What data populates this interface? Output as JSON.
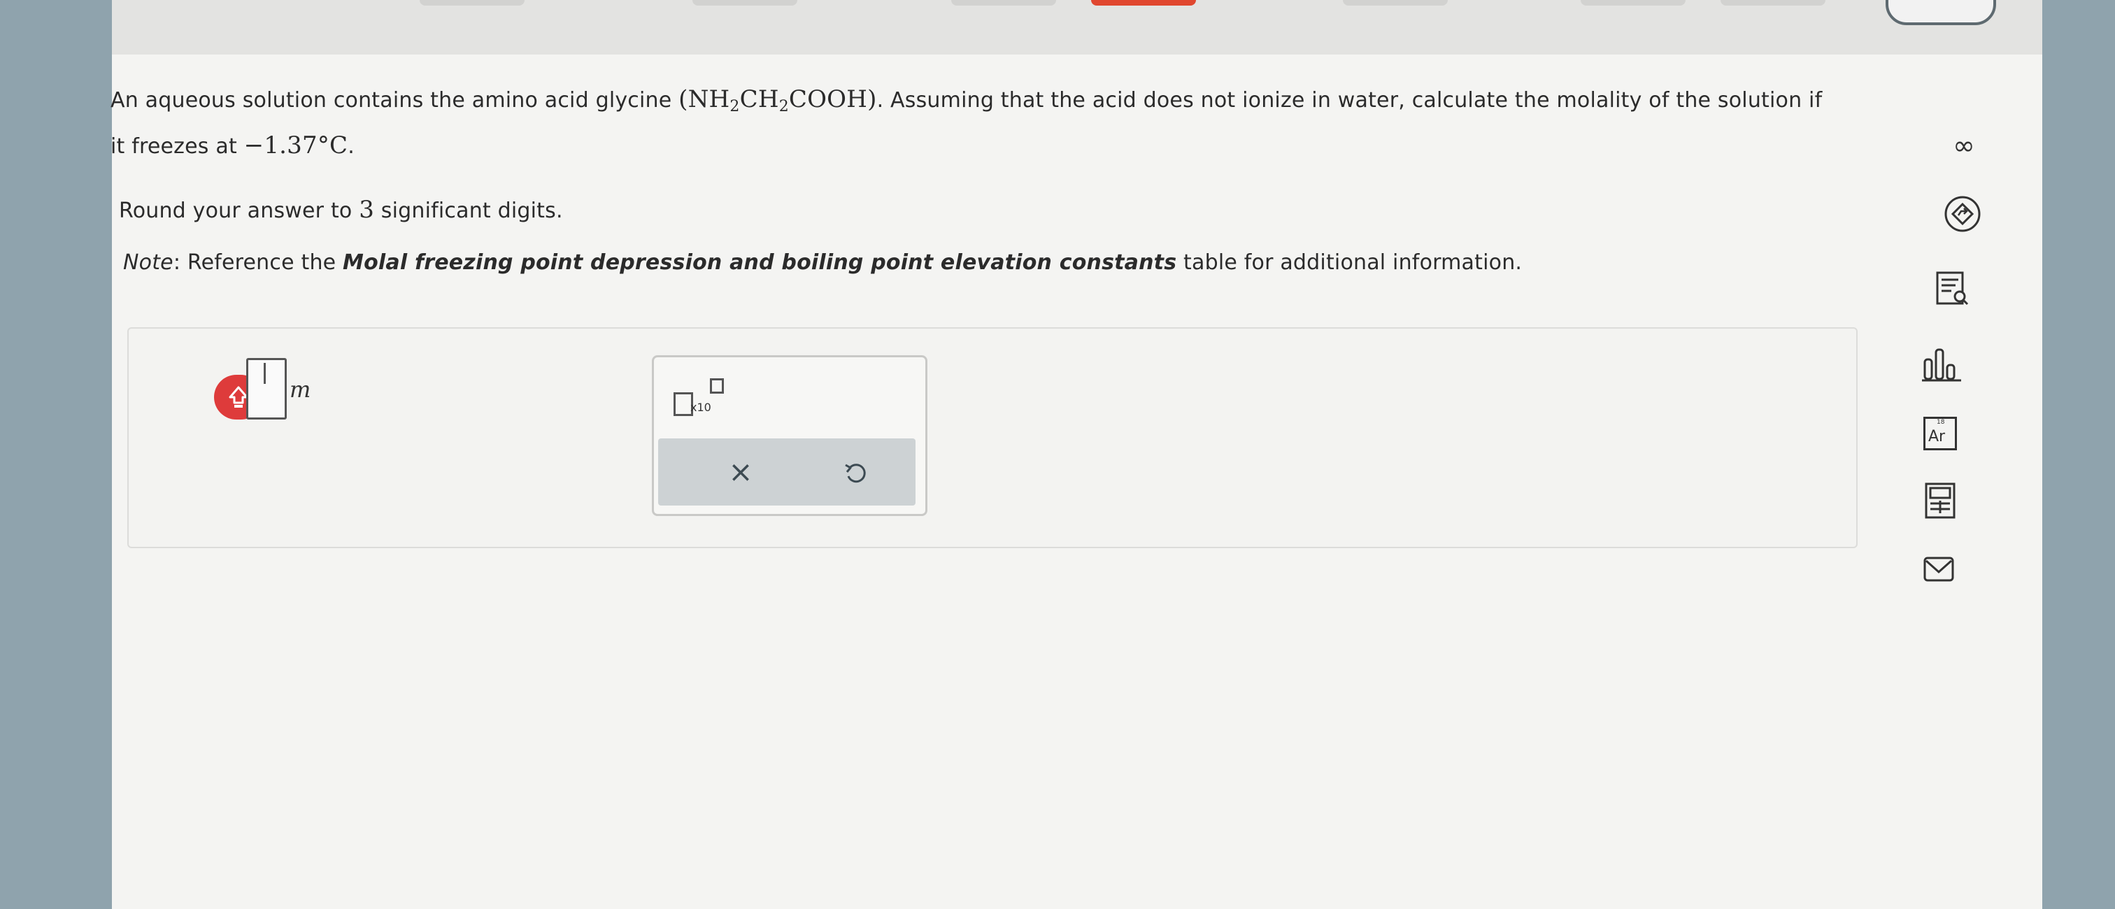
{
  "question": {
    "line1_a": "An aqueous solution contains the amino acid glycine ",
    "formula_open": "(NH",
    "sub1": "2",
    "formula_ch": "CH",
    "sub2": "2",
    "formula_close": "COOH)",
    "line1_b": ". Assuming that the acid does not ionize in water, calculate the molality of the solution if",
    "line2_a": "it freezes at ",
    "temperature": "−1.37°C",
    "line2_b": ".",
    "round_a": "Round your answer to ",
    "round_num": "3",
    "round_b": " significant digits.",
    "note_label": "Note",
    "note_a": ": Reference the ",
    "note_bold": "Molal freezing point depression and boiling point elevation constants",
    "note_b": " table for additional information."
  },
  "answer": {
    "value": "",
    "unit": "m"
  },
  "palette": {
    "sci_label": "x10",
    "clear_symbol": "×"
  },
  "sidebar": {
    "infinity_symbol": "∞",
    "periodic_number": "18",
    "periodic_symbol": "Ar"
  },
  "icons": [
    "help-icon",
    "clear-icon",
    "undo-icon",
    "explanation-icon",
    "textbook-icon",
    "data-chart-icon",
    "periodic-table-icon",
    "calculator-icon",
    "mail-icon"
  ],
  "colors": {
    "accent_red": "#de3b3b",
    "background": "#f4f4f2",
    "side_gutter": "#8fa3ad"
  }
}
